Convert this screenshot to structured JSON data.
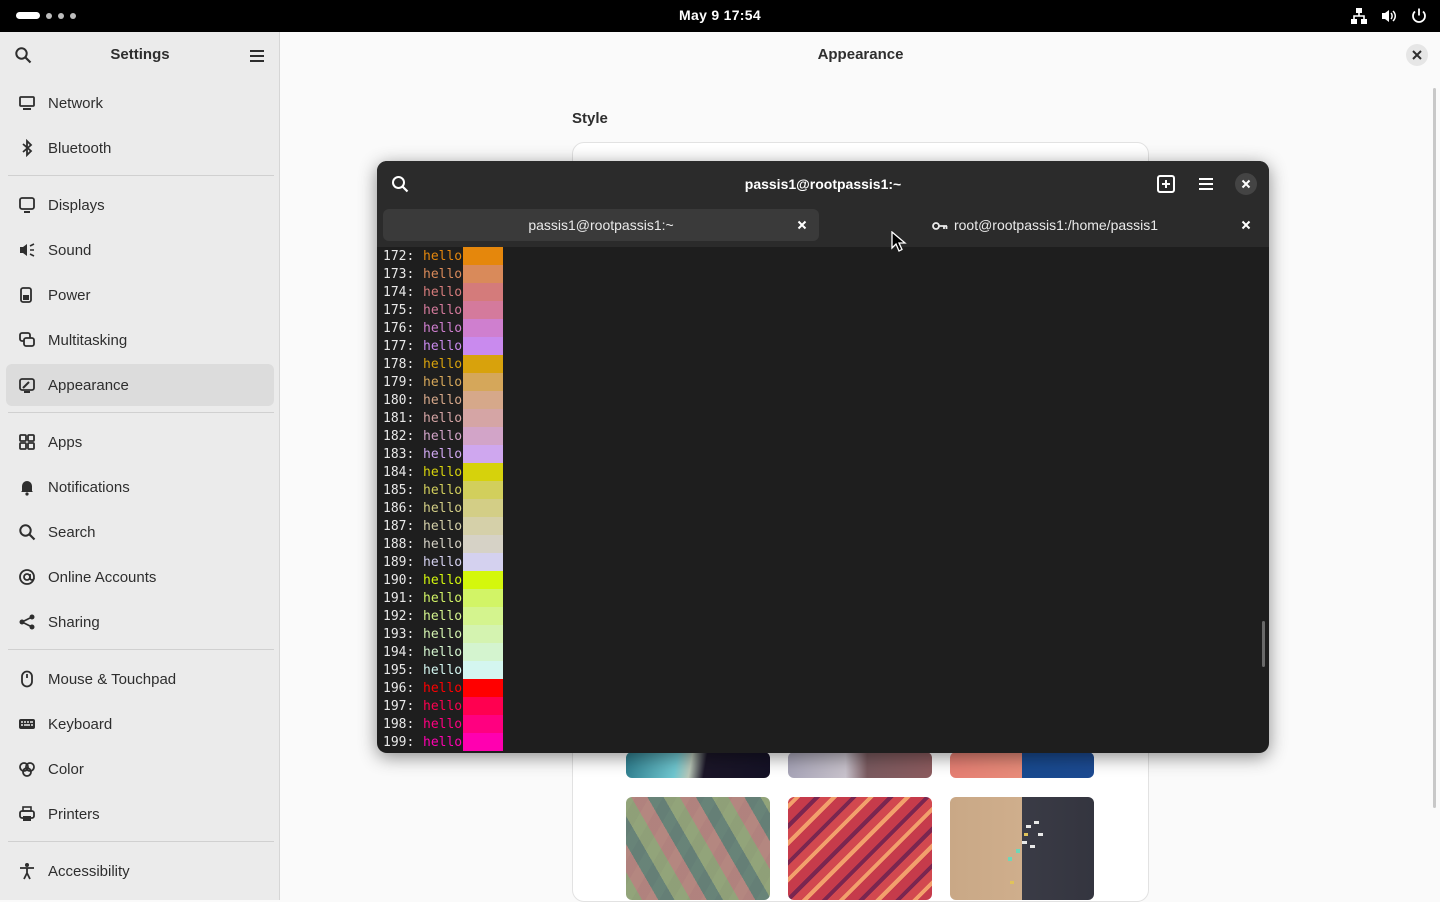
{
  "topbar": {
    "clock": "May 9  17:54",
    "icons": [
      "network-icon",
      "volume-icon",
      "power-icon"
    ]
  },
  "settings": {
    "title": "Settings",
    "search_icon": "search-icon",
    "menu_icon": "hamburger-menu-icon",
    "groups": [
      [
        {
          "label": "Network",
          "icon": "network-icon"
        },
        {
          "label": "Bluetooth",
          "icon": "bluetooth-icon"
        }
      ],
      [
        {
          "label": "Displays",
          "icon": "display-icon"
        },
        {
          "label": "Sound",
          "icon": "speaker-icon"
        },
        {
          "label": "Power",
          "icon": "battery-icon"
        },
        {
          "label": "Multitasking",
          "icon": "multitasking-icon"
        },
        {
          "label": "Appearance",
          "icon": "appearance-icon",
          "active": true
        }
      ],
      [
        {
          "label": "Apps",
          "icon": "apps-grid-icon"
        },
        {
          "label": "Notifications",
          "icon": "bell-icon"
        },
        {
          "label": "Search",
          "icon": "search-icon"
        },
        {
          "label": "Online Accounts",
          "icon": "at-sign-icon"
        },
        {
          "label": "Sharing",
          "icon": "share-icon"
        }
      ],
      [
        {
          "label": "Mouse & Touchpad",
          "icon": "mouse-icon"
        },
        {
          "label": "Keyboard",
          "icon": "keyboard-icon"
        },
        {
          "label": "Color",
          "icon": "color-icon"
        },
        {
          "label": "Printers",
          "icon": "printer-icon"
        }
      ],
      [
        {
          "label": "Accessibility",
          "icon": "accessibility-icon"
        }
      ]
    ]
  },
  "main": {
    "title": "Appearance",
    "section_label": "Style"
  },
  "terminal": {
    "title": "passis1@rootpassis1:~",
    "tabs": [
      {
        "label": "passis1@rootpassis1:~",
        "active": true,
        "icon": ""
      },
      {
        "label": "root@rootpassis1:/home/passis1",
        "active": false,
        "icon": "key-icon"
      }
    ],
    "lines": [
      {
        "num": "172:",
        "word": "hello",
        "color": "#e5870c",
        "swatch": "#e5870c"
      },
      {
        "num": "173:",
        "word": "hello",
        "color": "#d98a5a",
        "swatch": "#d98a5a"
      },
      {
        "num": "174:",
        "word": "hello",
        "color": "#d47b7b",
        "swatch": "#d47b7b"
      },
      {
        "num": "175:",
        "word": "hello",
        "color": "#d47a9c",
        "swatch": "#d47a9c"
      },
      {
        "num": "176:",
        "word": "hello",
        "color": "#cf7fcf",
        "swatch": "#cf7fcf"
      },
      {
        "num": "177:",
        "word": "hello",
        "color": "#c98aee",
        "swatch": "#c98aee"
      },
      {
        "num": "178:",
        "word": "hello",
        "color": "#d8a20c",
        "swatch": "#d8a20c"
      },
      {
        "num": "179:",
        "word": "hello",
        "color": "#d5a75a",
        "swatch": "#d5a75a"
      },
      {
        "num": "180:",
        "word": "hello",
        "color": "#d6a88a",
        "swatch": "#d6a88a"
      },
      {
        "num": "181:",
        "word": "hello",
        "color": "#d5a5a5",
        "swatch": "#d5a5a5"
      },
      {
        "num": "182:",
        "word": "hello",
        "color": "#d2a4c8",
        "swatch": "#d2a4c8"
      },
      {
        "num": "183:",
        "word": "hello",
        "color": "#cfa7ef",
        "swatch": "#cfa7ef"
      },
      {
        "num": "184:",
        "word": "hello",
        "color": "#d6d20c",
        "swatch": "#d6d20c"
      },
      {
        "num": "185:",
        "word": "hello",
        "color": "#d2cf5c",
        "swatch": "#d2cf5c"
      },
      {
        "num": "186:",
        "word": "hello",
        "color": "#d3ce86",
        "swatch": "#d3ce86"
      },
      {
        "num": "187:",
        "word": "hello",
        "color": "#d5d0a9",
        "swatch": "#d5d0a9"
      },
      {
        "num": "188:",
        "word": "hello",
        "color": "#d6d2c6",
        "swatch": "#d6d2c6"
      },
      {
        "num": "189:",
        "word": "hello",
        "color": "#d4d1ef",
        "swatch": "#d4d1ef"
      },
      {
        "num": "190:",
        "word": "hello",
        "color": "#d4f70c",
        "swatch": "#d4f70c"
      },
      {
        "num": "191:",
        "word": "hello",
        "color": "#d2f466",
        "swatch": "#d2f466"
      },
      {
        "num": "192:",
        "word": "hello",
        "color": "#d4f48e",
        "swatch": "#d4f48e"
      },
      {
        "num": "193:",
        "word": "hello",
        "color": "#d4f3b0",
        "swatch": "#d4f3b0"
      },
      {
        "num": "194:",
        "word": "hello",
        "color": "#d4f4cf",
        "swatch": "#d4f4cf"
      },
      {
        "num": "195:",
        "word": "hello",
        "color": "#d4f6f0",
        "swatch": "#d4f6f0"
      },
      {
        "num": "196:",
        "word": "hello",
        "color": "#ff0000",
        "swatch": "#ff0000"
      },
      {
        "num": "197:",
        "word": "hello",
        "color": "#ff0050",
        "swatch": "#ff0050"
      },
      {
        "num": "198:",
        "word": "hello",
        "color": "#ff0080",
        "swatch": "#ff0080"
      },
      {
        "num": "199:",
        "word": "hello",
        "color": "#ff00b0",
        "swatch": "#ff00b0"
      }
    ]
  }
}
